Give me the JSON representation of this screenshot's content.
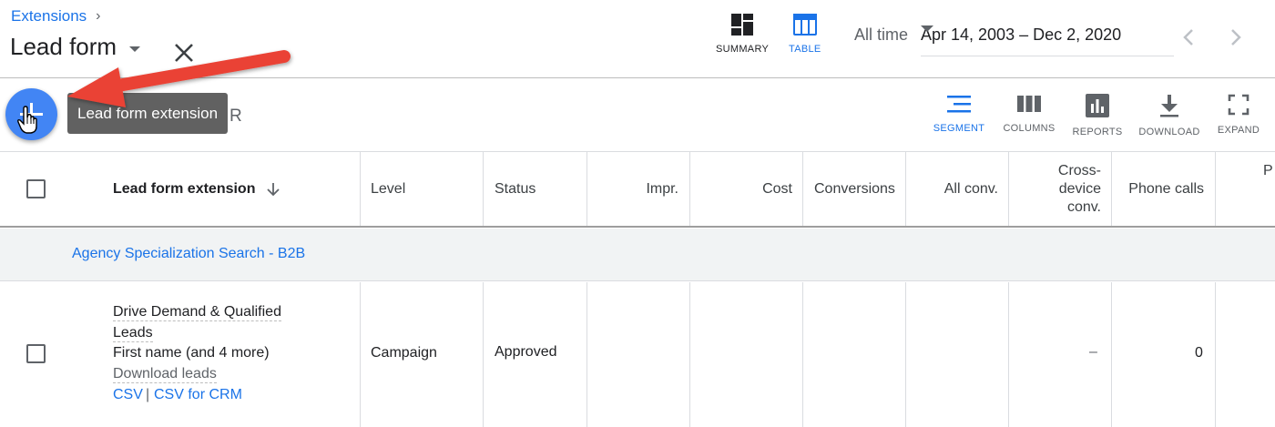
{
  "header": {
    "breadcrumb": "Extensions",
    "breadcrumb_sep": "›",
    "title": "Lead form",
    "views": {
      "summary": "SUMMARY",
      "table": "TABLE"
    },
    "date_preset": "All time",
    "date_range": "Apr 14, 2003 – Dec 2, 2020"
  },
  "toolbar": {
    "tooltip": "Lead form extension",
    "filter_letter": "R",
    "tools": {
      "segment": "SEGMENT",
      "columns": "COLUMNS",
      "reports": "REPORTS",
      "download": "DOWNLOAD",
      "expand": "EXPAND"
    }
  },
  "table": {
    "columns": {
      "extension": "Lead form extension",
      "level": "Level",
      "status": "Status",
      "impr": "Impr.",
      "cost": "Cost",
      "conversions": "Conversions",
      "all_conv": "All conv.",
      "cross_device_1": "Cross-",
      "cross_device_2": "device",
      "cross_device_3": "conv.",
      "phone_calls": "Phone calls",
      "next": "P"
    },
    "group": "Agency Specialization Search - B2B",
    "row": {
      "headline_1": "Drive Demand & Qualified",
      "headline_2": "Leads",
      "fields": "First name (and 4 more)",
      "download_label": "Download leads",
      "csv": "CSV",
      "sep": "|",
      "csv_crm": "CSV for CRM",
      "level": "Campaign",
      "status": "Approved",
      "cross_device_conv": "–",
      "phone_calls": "0"
    }
  },
  "colors": {
    "accent": "#1a73e8",
    "fab": "#4285f4",
    "annotation_arrow": "#ea4335"
  }
}
